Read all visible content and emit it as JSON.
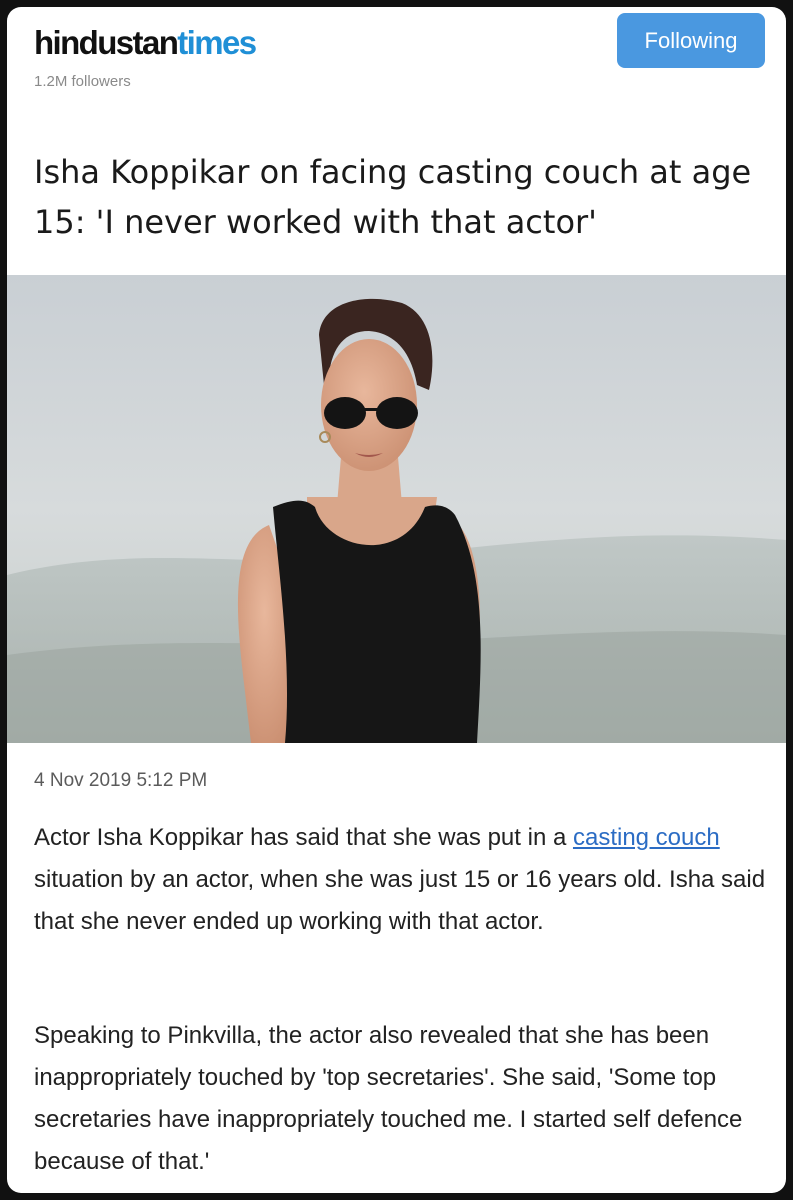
{
  "header": {
    "brand_part1": "hindustan",
    "brand_part2": "times",
    "followers": "1.2M followers",
    "follow_label": "Following"
  },
  "article": {
    "headline": "Isha Koppikar on facing casting couch at age 15: 'I never worked with that actor'",
    "timestamp": "4 Nov 2019 5:12 PM",
    "p1_before": "Actor Isha Koppikar has said that she was put in a ",
    "p1_link": "casting couch",
    "p1_after": " situation by an actor, when she was just 15 or 16 years old. Isha said that she never ended up working with that actor.",
    "p2": "Speaking to Pinkvilla, the actor also revealed that she has been inappropriately touched by 'top secretaries'. She said, 'Some top secretaries have inappropriately touched me. I started self defence because of that.'"
  },
  "colors": {
    "brand_accent": "#1f8fd6",
    "follow_button": "#4a98e0",
    "link": "#2b6cc4"
  }
}
